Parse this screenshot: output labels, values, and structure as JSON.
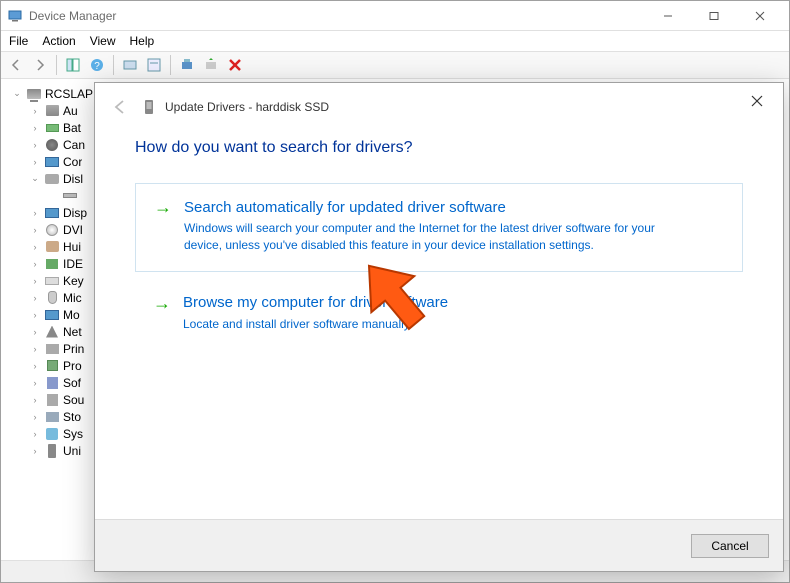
{
  "window": {
    "title": "Device Manager"
  },
  "menu": {
    "file": "File",
    "action": "Action",
    "view": "View",
    "help": "Help"
  },
  "tree": {
    "root": "RCSLAP",
    "items": [
      {
        "label": "Au",
        "icon": "audio"
      },
      {
        "label": "Bat",
        "icon": "batt"
      },
      {
        "label": "Can",
        "icon": "cam"
      },
      {
        "label": "Cor",
        "icon": "moni"
      },
      {
        "label": "Disl",
        "icon": "disk",
        "expanded": true,
        "children": [
          {
            "label": "",
            "icon": "drive"
          }
        ]
      },
      {
        "label": "Disp",
        "icon": "moni"
      },
      {
        "label": "DVI",
        "icon": "dvd"
      },
      {
        "label": "Hui",
        "icon": "hid"
      },
      {
        "label": "IDE",
        "icon": "ide"
      },
      {
        "label": "Key",
        "icon": "kb"
      },
      {
        "label": "Mic",
        "icon": "mouse"
      },
      {
        "label": "Mo",
        "icon": "moni"
      },
      {
        "label": "Net",
        "icon": "net"
      },
      {
        "label": "Prin",
        "icon": "print"
      },
      {
        "label": "Pro",
        "icon": "cpu"
      },
      {
        "label": "Sof",
        "icon": "soft"
      },
      {
        "label": "Sou",
        "icon": "sound"
      },
      {
        "label": "Sto",
        "icon": "stor"
      },
      {
        "label": "Sys",
        "icon": "sys"
      },
      {
        "label": "Uni",
        "icon": "usb"
      }
    ]
  },
  "dialog": {
    "title": "Update Drivers - harddisk SSD",
    "question": "How do you want to search for drivers?",
    "opt1_title": "Search automatically for updated driver software",
    "opt1_desc": "Windows will search your computer and the Internet for the latest driver software for your device, unless you've disabled this feature in your device installation settings.",
    "opt2_title": "Browse my computer for driver software",
    "opt2_desc": "Locate and install driver software manually.",
    "cancel": "Cancel"
  }
}
